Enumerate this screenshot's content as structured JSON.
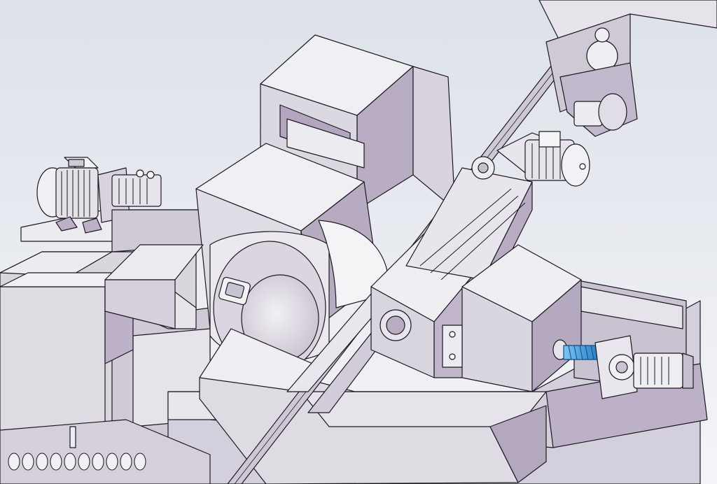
{
  "scene": {
    "description_visible_text": "",
    "palette": {
      "background_top": "#dfe3ea",
      "background_bottom": "#f3f4f8",
      "face_light": "#ecebef",
      "face_mid": "#d9d5de",
      "face_lilac": "#b6a9c0",
      "face_dark": "#9e90aa",
      "edge": "#1c1a20",
      "accent_blue": "#2b8fd6"
    },
    "icons": [
      "motor-left-icon",
      "motor-right-icon",
      "servo-motor-icon",
      "ballscrew-icon",
      "grinding-wheel-icon",
      "roller-conveyor-icon"
    ]
  }
}
